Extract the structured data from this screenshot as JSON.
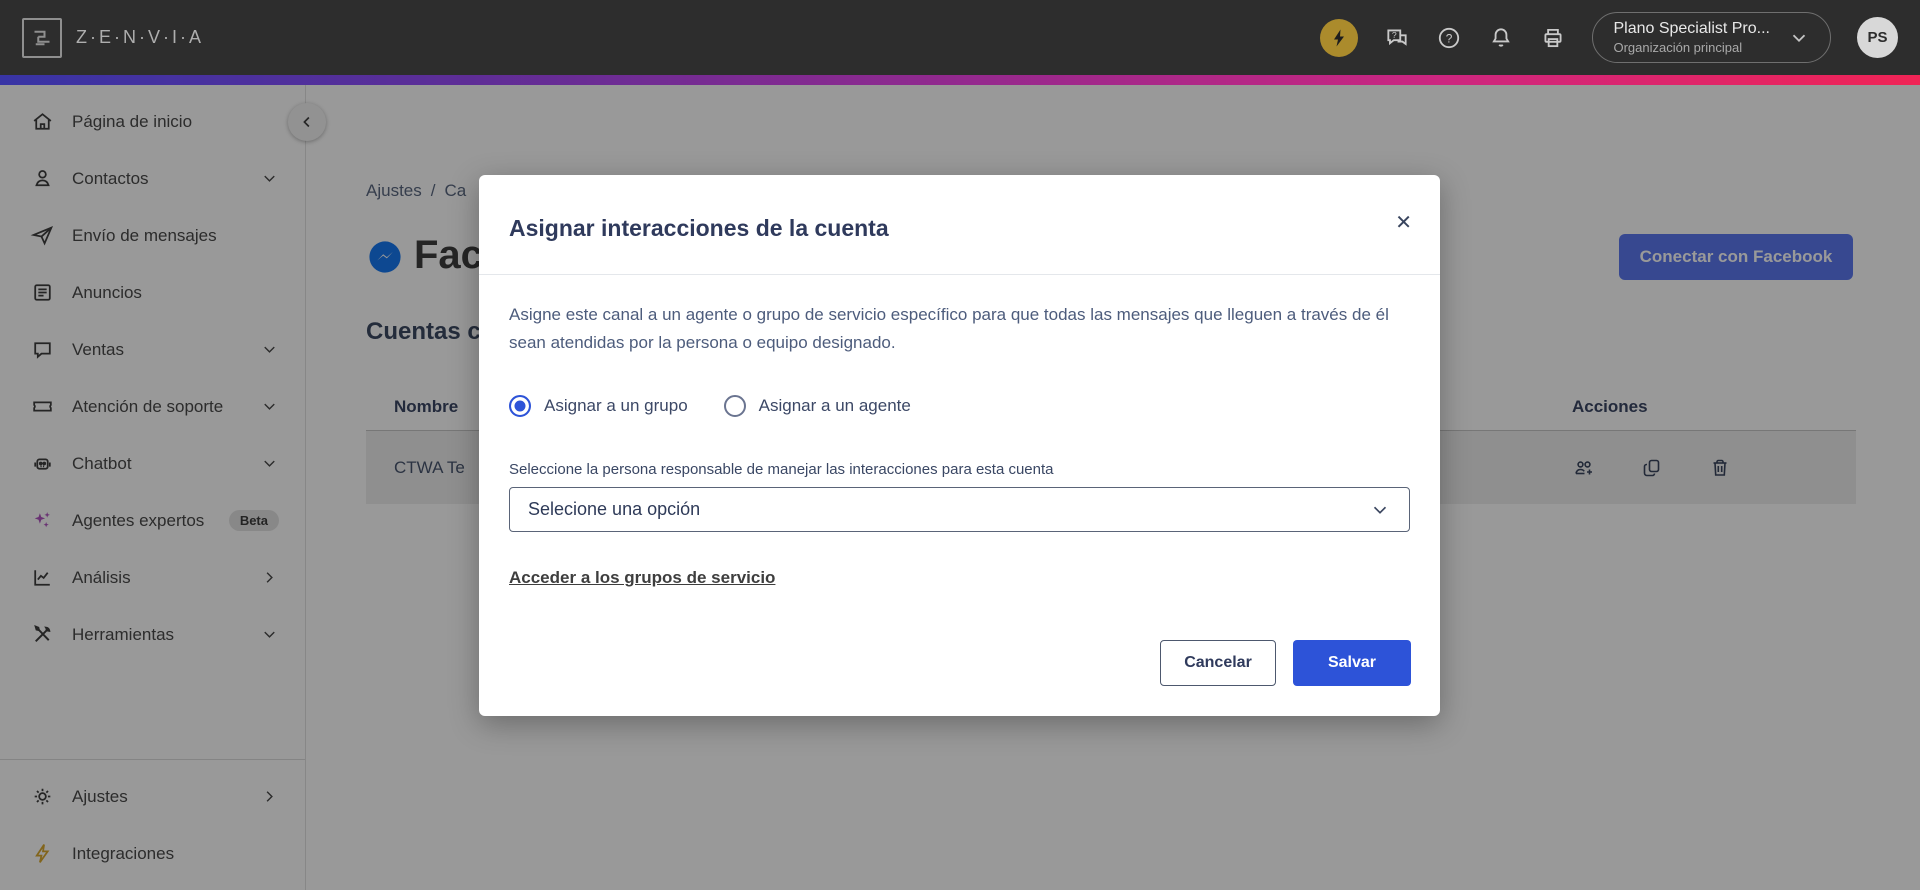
{
  "topbar": {
    "brand": "Z·E·N·V·I·A",
    "plan": {
      "title": "Plano Specialist Pro...",
      "subtitle": "Organización principal"
    },
    "avatar_initials": "PS"
  },
  "sidebar": {
    "items": [
      {
        "label": "Página de inicio"
      },
      {
        "label": "Contactos"
      },
      {
        "label": "Envío de mensajes"
      },
      {
        "label": "Anuncios"
      },
      {
        "label": "Ventas"
      },
      {
        "label": "Atención de soporte"
      },
      {
        "label": "Chatbot"
      },
      {
        "label": "Agentes expertos",
        "badge": "Beta"
      },
      {
        "label": "Análisis"
      },
      {
        "label": "Herramientas"
      }
    ],
    "footer_items": [
      {
        "label": "Ajustes"
      },
      {
        "label": "Integraciones"
      }
    ]
  },
  "main": {
    "breadcrumb": {
      "crumb1": "Ajustes",
      "separator": "/",
      "crumb2": "Ca"
    },
    "page_title": "Fac",
    "connect_button": "Conectar con Facebook",
    "section_title": "Cuentas co",
    "table": {
      "col_name": "Nombre",
      "col_actions": "Acciones",
      "rows": [
        {
          "name": "CTWA Te"
        }
      ]
    }
  },
  "modal": {
    "title": "Asignar interacciones de la cuenta",
    "close": "✕",
    "description": "Asigne este canal a un agente o grupo de servicio específico para que todas las mensajes que lleguen a través de él sean atendidas por la persona o equipo designado.",
    "radios": {
      "group": "Asignar a un grupo",
      "agent": "Asignar a un agente"
    },
    "select_label": "Seleccione la persona responsable de manejar las interacciones para esta cuenta",
    "select_value": "Selecione una opción",
    "link": "Acceder a los grupos de servicio",
    "cancel_button": "Cancelar",
    "save_button": "Salvar"
  },
  "colors": {
    "primary_blue": "#2d53d8",
    "topbar_bg": "#2d2d2d",
    "gold_accent": "#ab8b2c",
    "messenger_blue": "#1778f2",
    "gradient": [
      "#3834a5",
      "#93298e",
      "#f02455"
    ],
    "overlay": "rgba(0,0,0,0.40)"
  }
}
